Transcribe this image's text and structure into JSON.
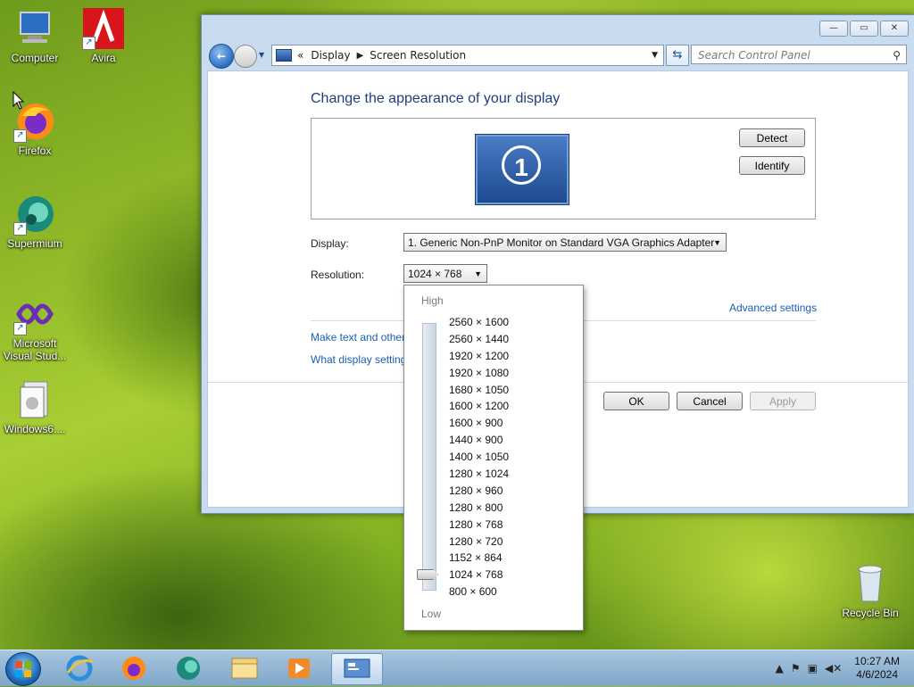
{
  "desktop": {
    "icons": [
      {
        "label": "Computer"
      },
      {
        "label": "Avira"
      },
      {
        "label": "Firefox"
      },
      {
        "label": "Supermium"
      },
      {
        "label": "Microsoft Visual Stud..."
      },
      {
        "label": "Windows6...."
      },
      {
        "label": "Recycle Bin"
      }
    ]
  },
  "window": {
    "controls": {
      "minimize": "—",
      "maximize": "▭",
      "close": "✕"
    },
    "address": {
      "root": "«",
      "crumbs": [
        "Display",
        "Screen Resolution"
      ]
    },
    "search_placeholder": "Search Control Panel",
    "heading": "Change the appearance of your display",
    "monitor_number": "1",
    "detect_label": "Detect",
    "identify_label": "Identify",
    "display_label": "Display:",
    "display_value": "1. Generic Non-PnP Monitor on Standard VGA Graphics Adapter",
    "resolution_label": "Resolution:",
    "resolution_value": "1024 × 768",
    "advanced_settings": "Advanced settings",
    "link_text_size": "Make text and other",
    "link_display_settings": "What display setting",
    "ok_label": "OK",
    "cancel_label": "Cancel",
    "apply_label": "Apply"
  },
  "resolution_dropdown": {
    "high_label": "High",
    "low_label": "Low",
    "selected": "1024 × 768",
    "options": [
      "2560 × 1600",
      "2560 × 1440",
      "1920 × 1200",
      "1920 × 1080",
      "1680 × 1050",
      "1600 × 1200",
      "1600 × 900",
      "1440 × 900",
      "1400 × 1050",
      "1280 × 1024",
      "1280 × 960",
      "1280 × 800",
      "1280 × 768",
      "1280 × 720",
      "1152 × 864",
      "1024 × 768",
      "800 × 600"
    ]
  },
  "taskbar": {
    "time": "10:27 AM",
    "date": "4/6/2024",
    "pinned": [
      "internet-explorer-icon",
      "firefox-icon",
      "supermium-icon",
      "file-explorer-icon",
      "media-player-icon",
      "control-panel-icon"
    ]
  }
}
